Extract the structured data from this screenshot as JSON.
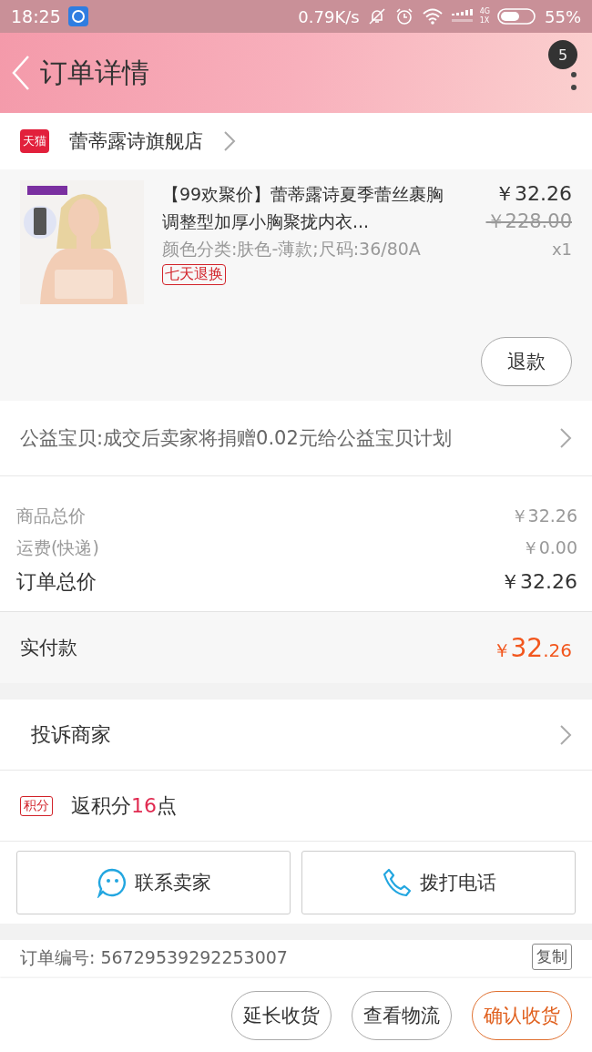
{
  "status_bar": {
    "time": "18:25",
    "speed": "0.79K/s",
    "network": "4G",
    "network_sub": "1X",
    "battery_text": "55%"
  },
  "header": {
    "title": "订单详情",
    "badge": "5"
  },
  "shop": {
    "logo": "天猫",
    "name": "蕾蒂露诗旗舰店"
  },
  "product": {
    "kind": "picture",
    "title": "【99欢聚价】蕾蒂露诗夏季蕾丝裹胸调整型加厚小胸聚拢内衣...",
    "sku": "颜色分类:肤色-薄款;尺码:36/80A",
    "tag": "七天退换",
    "price": "￥32.26",
    "original_price": "￥228.00",
    "quantity": "x1",
    "refund_button": "退款"
  },
  "charity": {
    "text": "公益宝贝:成交后卖家将捐赠0.02元给公益宝贝计划"
  },
  "summary": [
    {
      "label": "商品总价",
      "value": "￥32.26",
      "kind": "minor"
    },
    {
      "label": "运费(快递)",
      "value": "￥0.00",
      "kind": "minor"
    },
    {
      "label": "订单总价",
      "value": "￥32.26",
      "kind": "major"
    }
  ],
  "paid": {
    "label": "实付款",
    "currency": "￥",
    "integer": "32",
    "decimal": ".26"
  },
  "complain": {
    "label": "投诉商家"
  },
  "points": {
    "badge": "积分",
    "prefix": "返积分",
    "amount": "16",
    "suffix": "点"
  },
  "contact_buttons": [
    {
      "label": "联系卖家",
      "kind": "chat"
    },
    {
      "label": "拨打电话",
      "kind": "phone"
    }
  ],
  "order_info": {
    "label": "订单编号:",
    "number": "56729539292253007",
    "copy_button": "复制"
  },
  "bottom_buttons": [
    {
      "label": "延长收货",
      "primary": false
    },
    {
      "label": "查看物流",
      "primary": false
    },
    {
      "label": "确认收货",
      "primary": true
    }
  ]
}
